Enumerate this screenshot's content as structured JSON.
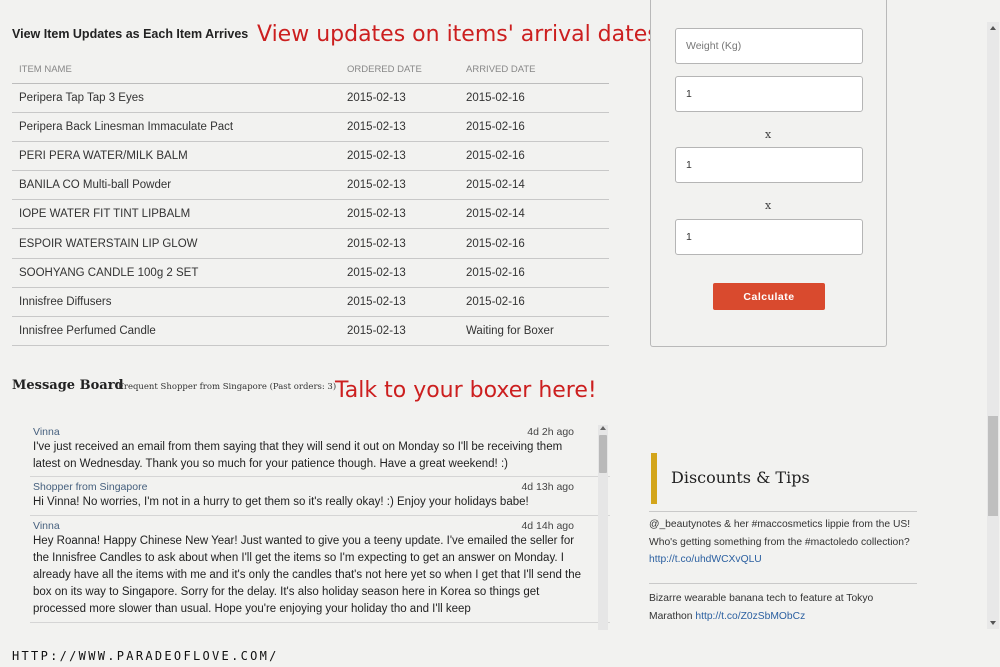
{
  "items_section": {
    "heading": "View Item Updates as Each Item Arrives",
    "annotation": "View updates on items' arrival dates!",
    "columns": [
      "ITEM NAME",
      "ORDERED DATE",
      "ARRIVED DATE"
    ],
    "rows": [
      [
        "Peripera Tap Tap 3 Eyes",
        "2015-02-13",
        "2015-02-16"
      ],
      [
        "Peripera Back Linesman Immaculate Pact",
        "2015-02-13",
        "2015-02-16"
      ],
      [
        "PERI PERA WATER/MILK BALM",
        "2015-02-13",
        "2015-02-16"
      ],
      [
        "BANILA CO Multi-ball Powder",
        "2015-02-13",
        "2015-02-14"
      ],
      [
        "IOPE WATER FIT TINT LIPBALM",
        "2015-02-13",
        "2015-02-14"
      ],
      [
        "ESPOIR WATERSTAIN LIP GLOW",
        "2015-02-13",
        "2015-02-16"
      ],
      [
        "SOOHYANG CANDLE 100g 2 SET",
        "2015-02-13",
        "2015-02-16"
      ],
      [
        "Innisfree Diffusers",
        "2015-02-13",
        "2015-02-16"
      ],
      [
        "Innisfree Perfumed Candle",
        "2015-02-13",
        "Waiting for Boxer"
      ]
    ]
  },
  "calculator": {
    "weight_placeholder": "Weight (Kg)",
    "length_value": "1",
    "width_value": "1",
    "height_value": "1",
    "times_symbol": "x",
    "button_label": "Calculate",
    "button_color": "#d94a2e"
  },
  "message_board": {
    "title": "Message Board",
    "subtitle": "Frequent Shopper from Singapore (Past orders: 3)",
    "annotation": "Talk to your boxer here!",
    "messages": [
      {
        "author": "Vinna",
        "time": "4d 2h ago",
        "text": "I've just received an email from them saying that they will send it out on Monday so I'll be receiving them latest on Wednesday. Thank you so much for your patience though. Have a great weekend! :)"
      },
      {
        "author": "Shopper from Singapore",
        "time": "4d 13h ago",
        "text": "Hi Vinna! No worries, I'm not in a hurry to get them so it's really okay! :) Enjoy your holidays babe!"
      },
      {
        "author": "Vinna",
        "time": "4d 14h ago",
        "text": "Hey Roanna! Happy Chinese New Year! Just wanted to give you a teeny update. I've emailed the seller for the Innisfree Candles to ask about when I'll get the items so I'm expecting to get an answer on Monday. I already have all the items with me and it's only the candles that's not here yet so when I get that I'll send the box on its way to Singapore. Sorry for the delay. It's also holiday season here in Korea so things get processed more slower than usual. Hope you're enjoying your holiday tho and I'll keep"
      }
    ]
  },
  "discounts": {
    "title": "Discounts & Tips",
    "accent_color": "#d3a51a",
    "tips": [
      {
        "text_a": "@_beautynotes & her #maccosmetics lippie from the US! Who's getting something from the #mactoledo collection? ",
        "link": "http://t.co/uhdWCXvQLU"
      },
      {
        "text_a": "Bizarre wearable banana tech to feature at Tokyo Marathon ",
        "link": "http://t.co/Z0zSbMObCz"
      }
    ]
  },
  "watermark": "HTTP://WWW.PARADEOFLOVE.COM/"
}
